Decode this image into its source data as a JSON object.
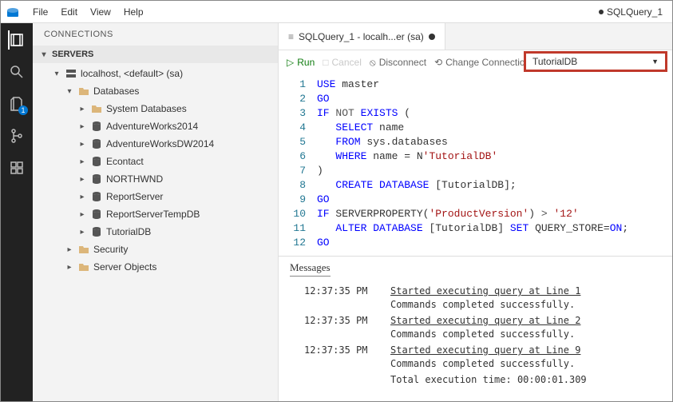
{
  "menubar": {
    "items": [
      "File",
      "Edit",
      "View",
      "Help"
    ],
    "rightLabel": "SQLQuery_1"
  },
  "activity": {
    "badge": "1"
  },
  "sidebar": {
    "title": "CONNECTIONS",
    "section": "SERVERS",
    "server": "localhost, <default> (sa)",
    "groups": {
      "databases": "Databases",
      "security": "Security",
      "serverObjects": "Server Objects"
    },
    "dbs": [
      "System Databases",
      "AdventureWorks2014",
      "AdventureWorksDW2014",
      "Econtact",
      "NORTHWND",
      "ReportServer",
      "ReportServerTempDB",
      "TutorialDB"
    ]
  },
  "tab": {
    "label": "SQLQuery_1 - localh...er (sa)"
  },
  "toolbar": {
    "run": "Run",
    "cancel": "Cancel",
    "disconnect": "Disconnect",
    "changeConn": "Change Connection",
    "dbSelected": "TutorialDB"
  },
  "code": {
    "lines": [
      {
        "n": 1,
        "html": "<span class='kw'>USE</span> master"
      },
      {
        "n": 2,
        "html": "<span class='kw'>GO</span>"
      },
      {
        "n": 3,
        "html": "<span class='kw'>IF</span> <span class='op'>NOT</span> <span class='kw'>EXISTS</span> ("
      },
      {
        "n": 4,
        "html": "   <span class='kw'>SELECT</span> name"
      },
      {
        "n": 5,
        "html": "   <span class='kw'>FROM</span> sys.databases"
      },
      {
        "n": 6,
        "html": "   <span class='kw'>WHERE</span> name = N<span class='str'>'TutorialDB'</span>"
      },
      {
        "n": 7,
        "html": ")"
      },
      {
        "n": 8,
        "html": "   <span class='kw'>CREATE</span> <span class='kw'>DATABASE</span> [TutorialDB];"
      },
      {
        "n": 9,
        "html": "<span class='kw'>GO</span>"
      },
      {
        "n": 10,
        "html": "<span class='kw'>IF</span> SERVERPROPERTY(<span class='str'>'ProductVersion'</span>) <span class='op'>&gt;</span> <span class='str'>'12'</span>"
      },
      {
        "n": 11,
        "html": "   <span class='kw'>ALTER</span> <span class='kw'>DATABASE</span> [TutorialDB] <span class='kw'>SET</span> QUERY_STORE=<span class='kw'>ON</span>;"
      },
      {
        "n": 12,
        "html": "<span class='kw'>GO</span>"
      }
    ]
  },
  "messages": {
    "header": "Messages",
    "rows": [
      {
        "t": "12:37:35 PM",
        "a": "Started executing query at Line 1",
        "b": "Commands completed successfully."
      },
      {
        "t": "12:37:35 PM",
        "a": "Started executing query at Line 2",
        "b": "Commands completed successfully."
      },
      {
        "t": "12:37:35 PM",
        "a": "Started executing query at Line 9",
        "b": "Commands completed successfully."
      }
    ],
    "total": "Total execution time: 00:00:01.309"
  }
}
